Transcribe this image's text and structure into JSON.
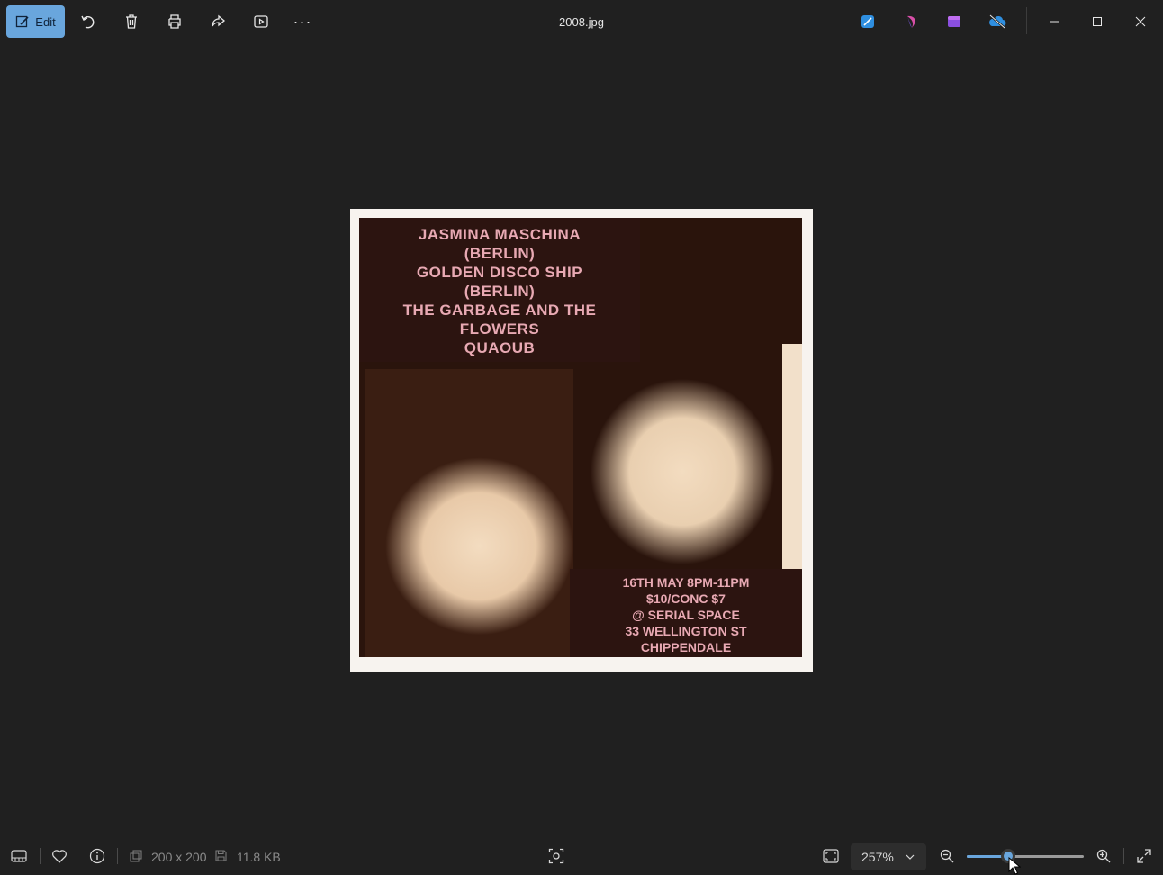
{
  "toolbar": {
    "edit_label": "Edit",
    "more_label": "···",
    "filename": "2008.jpg"
  },
  "poster": {
    "bands": [
      "JASMINA MASCHINA",
      "(BERLIN)",
      "GOLDEN DISCO SHIP",
      "(BERLIN)",
      "THE GARBAGE AND THE",
      "FLOWERS",
      "QUAOUB"
    ],
    "info": [
      "16TH MAY 8PM-11PM",
      "$10/CONC $7",
      "@ SERIAL SPACE",
      "33 WELLINGTON ST",
      "CHIPPENDALE"
    ]
  },
  "statusbar": {
    "dimensions": "200 x 200",
    "file_size": "11.8 KB",
    "zoom": "257%",
    "zoom_slider_fraction": 0.35
  },
  "colors": {
    "accent": "#69a6dd",
    "background": "#202020",
    "poster_text": "#e8a9b3"
  }
}
